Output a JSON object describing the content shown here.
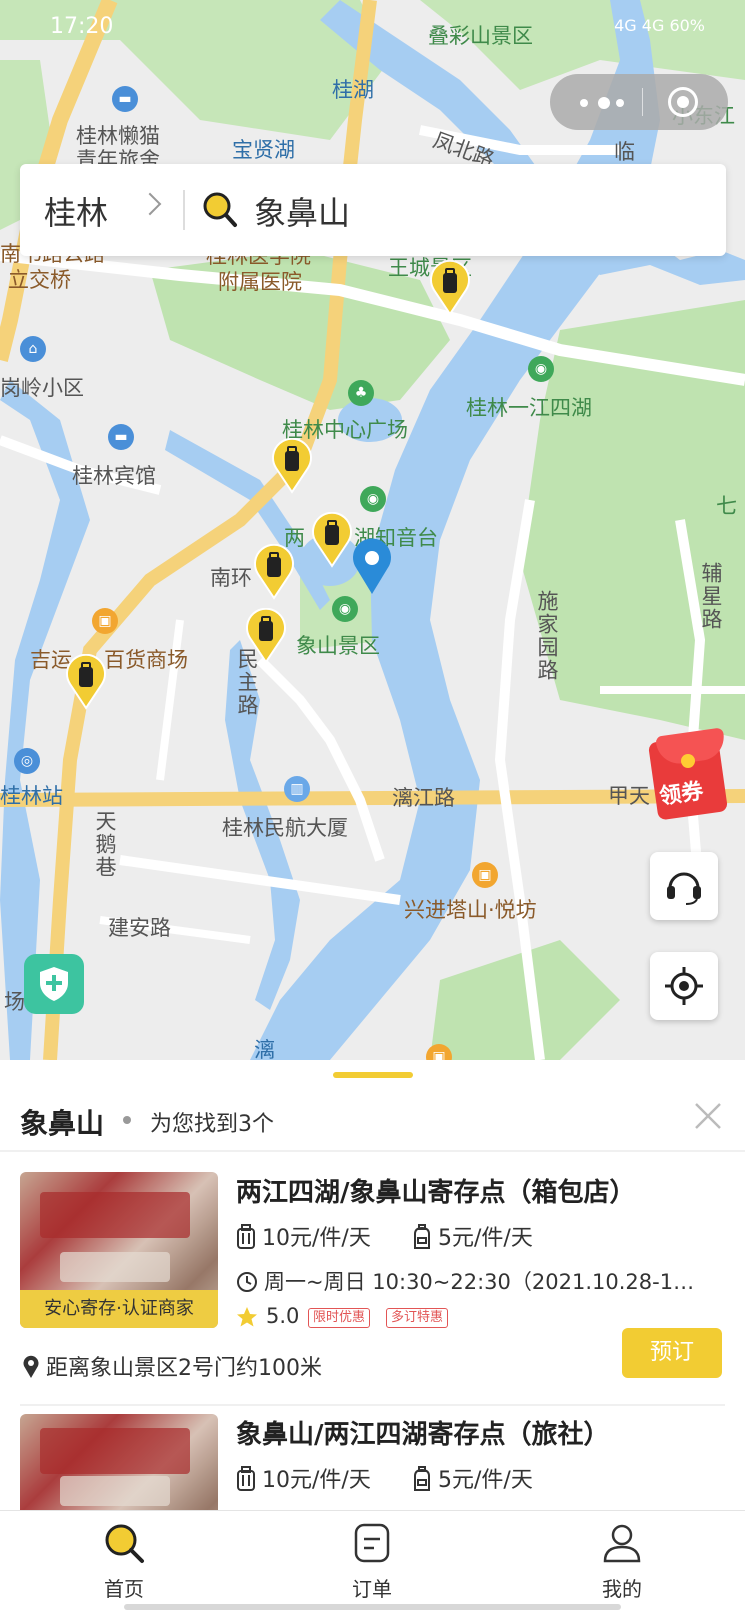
{
  "status_bar": {
    "time": "17:20",
    "right": "4G 4G 60%"
  },
  "search": {
    "city": "桂林",
    "query": "象鼻山"
  },
  "map": {
    "labels": {
      "diecai": "叠彩山景区",
      "guihu": "桂湖",
      "lanmao": "桂林懒猫",
      "lanmao2": "青年旅舍",
      "baoxian": "宝贤湖",
      "fengbei": "凤北路",
      "xiaodong": "小东江",
      "xiaodong_lin": "临",
      "nanshi": "南书路公路",
      "lijiaoqiao": "立交桥",
      "yixueyuan": "桂林医学院",
      "fushu": "附属医院",
      "wangcheng": "王城景区",
      "gangling": "岗岭小区",
      "zhongxin": "桂林中心广场",
      "yijiang": "桂林一江四湖",
      "qi": "七",
      "binguan": "桂林宾馆",
      "zhiyin_a": "两",
      "zhiyin_b": "湖知音台",
      "nanhuan": "南环",
      "shijia": "施家园路",
      "fuxing": "辅星路",
      "xiangshan": "象山景区",
      "minzhu": "民主路",
      "jiyun": "吉运",
      "baihuo": "百货商场",
      "guilinzhan": "桂林站",
      "tiane": "天鹅巷",
      "lijiang": "漓江路",
      "jiatian": "甲天",
      "minhang": "桂林民航大厦",
      "xingjin": "兴进塔山·悦坊",
      "jianan": "建安路",
      "chang": "场",
      "li": "漓"
    },
    "redpacket_label": "领券"
  },
  "sheet": {
    "keyword": "象鼻山",
    "found": "为您找到3个",
    "cards": [
      {
        "title": "两江四湖/象鼻山寄存点（箱包店）",
        "price_box": "10元/件/天",
        "price_bag": "5元/件/天",
        "hours": "周一~周日 10:30~22:30（2021.10.28-12.31…",
        "ribbon": "安心寄存·认证商家",
        "rating": "5.0",
        "tags": [
          "限时优惠",
          "多订特惠"
        ],
        "distance": "距离象山景区2号门约100米",
        "book": "预订"
      },
      {
        "title": "象鼻山/两江四湖寄存点（旅社）",
        "price_box": "10元/件/天",
        "price_bag": "5元/件/天"
      }
    ]
  },
  "tabs": [
    {
      "label": "首页",
      "icon": "search-icon"
    },
    {
      "label": "订单",
      "icon": "order-icon"
    },
    {
      "label": "我的",
      "icon": "profile-icon"
    }
  ],
  "colors": {
    "accent": "#f2cc33",
    "water": "#a6cdf2",
    "park": "#bfe3b0",
    "road": "#f5d27a",
    "pin_blue": "#2a8bd8"
  }
}
